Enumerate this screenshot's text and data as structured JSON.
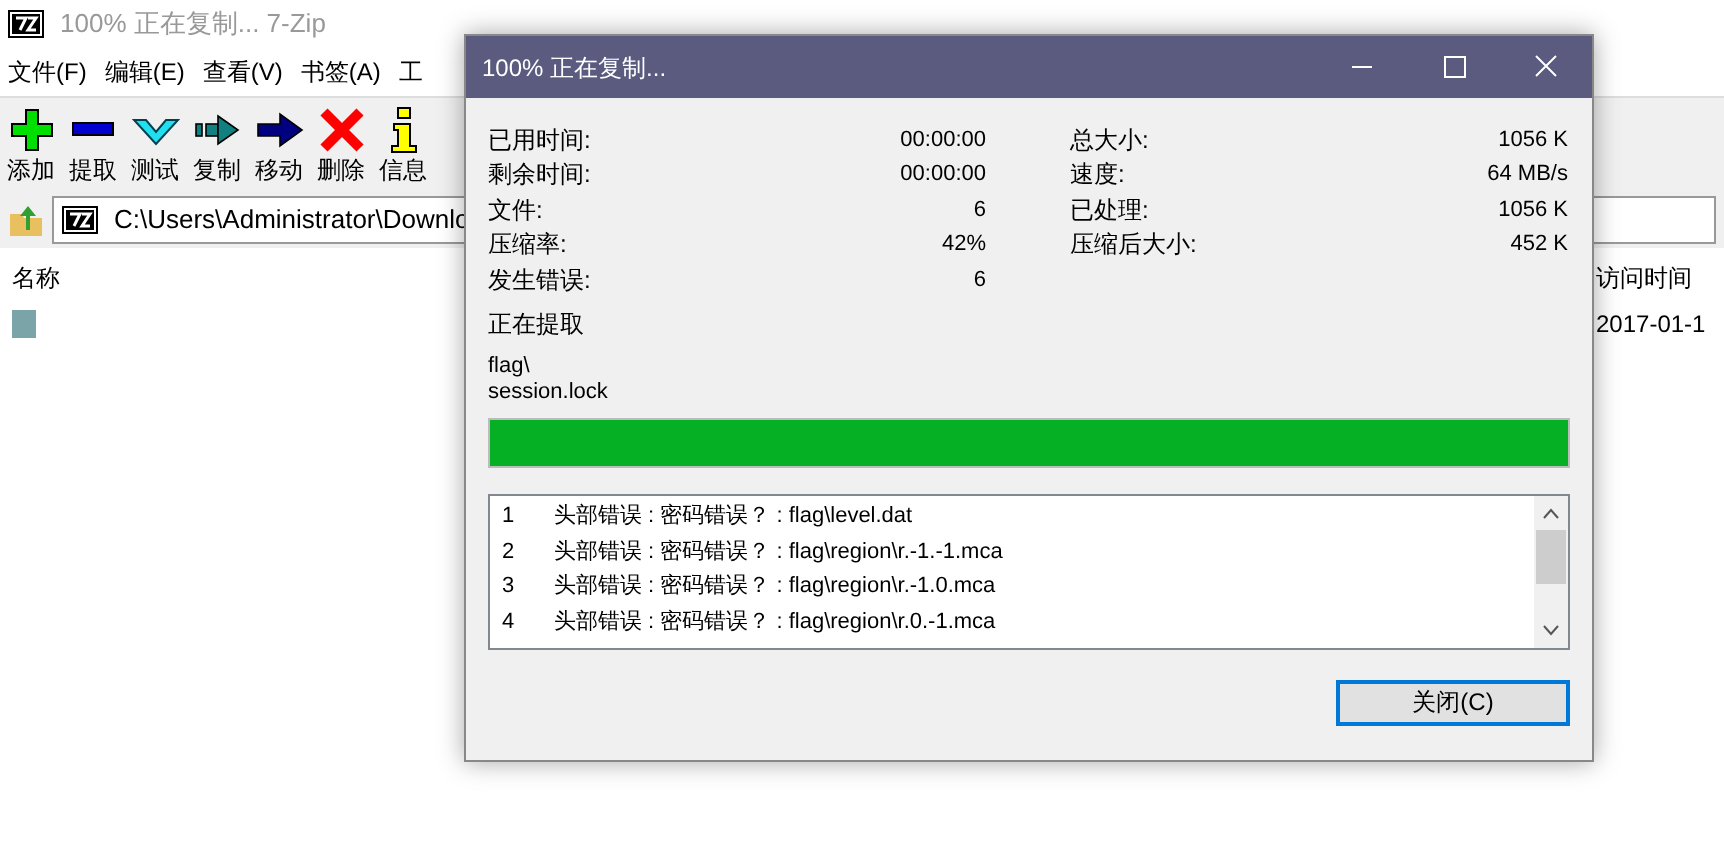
{
  "main_window": {
    "title": "100% 正在复制... 7-Zip",
    "menu": [
      "文件(F)",
      "编辑(E)",
      "查看(V)",
      "书签(A)",
      "工"
    ],
    "toolbar": [
      {
        "kind": "add",
        "label": "添加"
      },
      {
        "kind": "extract",
        "label": "提取"
      },
      {
        "kind": "test",
        "label": "测试"
      },
      {
        "kind": "copy",
        "label": "复制"
      },
      {
        "kind": "move",
        "label": "移动"
      },
      {
        "kind": "delete",
        "label": "删除"
      },
      {
        "kind": "info",
        "label": "信息"
      }
    ],
    "address": "C:\\Users\\Administrator\\Downlo",
    "columns": [
      {
        "label": "名称"
      },
      {
        "label": "访问时间"
      }
    ],
    "row": {
      "column_2": "2017-01-1"
    }
  },
  "dialog": {
    "title": "100% 正在复制...",
    "left_stats": [
      {
        "label": "已用时间:",
        "value": "00:00:00"
      },
      {
        "label": "剩余时间:",
        "value": "00:00:00"
      },
      {
        "label": "文件:",
        "value": "6"
      },
      {
        "label": "压缩率:",
        "value": "42%"
      },
      {
        "label": "发生错误:",
        "value": "6"
      }
    ],
    "right_stats": [
      {
        "label": "总大小:",
        "value": "1056 K"
      },
      {
        "label": "速度:",
        "value": "64 MB/s"
      },
      {
        "label": "已处理:",
        "value": "1056 K"
      },
      {
        "label": "压缩后大小:",
        "value": "452 K"
      }
    ],
    "operation": "正在提取",
    "current_path": "flag\\",
    "current_file": "session.lock",
    "progress": {
      "level": 1
    },
    "log": [
      {
        "number": "1",
        "message": "头部错误 : 密码错误？ : flag\\level.dat"
      },
      {
        "number": "2",
        "message": "头部错误 : 密码错误？ : flag\\region\\r.-1.-1.mca"
      },
      {
        "number": "3",
        "message": "头部错误 : 密码错误？ : flag\\region\\r.-1.0.mca"
      },
      {
        "number": "4",
        "message": "头部错误 : 密码错误？ : flag\\region\\r.0.-1.mca"
      }
    ],
    "close_button": "关闭(C)"
  }
}
